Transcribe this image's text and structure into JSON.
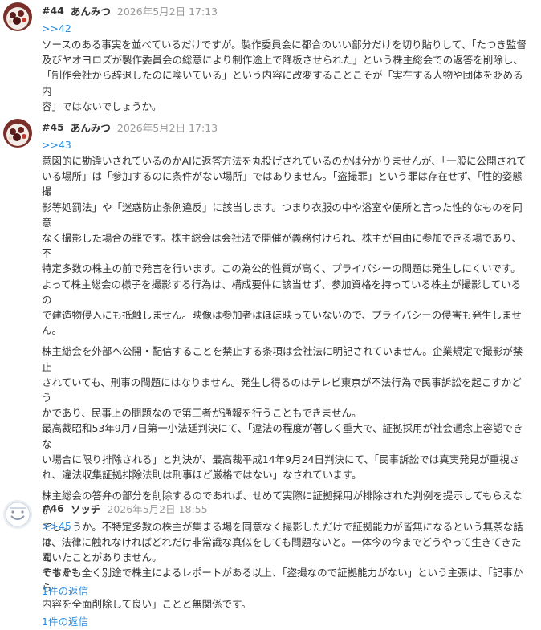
{
  "posts": [
    {
      "number": "#44",
      "name": "あんみつ",
      "date": "2026年5月2日 17:13",
      "anchor": ">>42",
      "lines": [
        "ソースのある事実を並べているだけですが。製作委員会に都合のいい部分だけを切り貼りして、「たつき監督",
        "及びヤオヨロズが製作委員会の総意により制作途上で降板させられた」という株主総会での返答を削除し、",
        "「制作会社から辞退したのに喚いている」という内容に改変することこそが「実在する人物や団体を貶める内",
        "容」ではないでしょうか。"
      ]
    },
    {
      "number": "#45",
      "name": "あんみつ",
      "date": "2026年5月2日 17:13",
      "anchor": ">>43",
      "blocks": [
        [
          "意図的に勘違いされているのかAIに返答方法を丸投げされているのかは分かりませんが、「一般に公開されて",
          "いる場所」は「参加するのに条件がない場所」ではありません。「盗撮罪」という罪は存在せず、「性的姿態撮",
          "影等処罰法」や「迷惑防止条例違反」に該当します。つまり衣服の中や浴室や便所と言った性的なものを同意",
          "なく撮影した場合の罪です。株主総会は会社法で開催が義務付けられ、株主が自由に参加できる場であり、不",
          "特定多数の株主の前で発言を行います。この為公的性質が高く、プライバシーの問題は発生しにくいです。",
          "よって株主総会の様子を撮影する行為は、構成要件に該当せず、参加資格を持っている株主が撮影しているの",
          "で建造物侵入にも抵触しません。映像は参加者はほぼ映っていないので、プライバシーの侵害も発生しませ",
          "ん。"
        ],
        [
          "株主総会を外部へ公開・配信することを禁止する条項は会社法に明記されていません。企業規定で撮影が禁止",
          "されていても、刑事の問題にはなりません。発生し得るのはテレビ東京が不法行為で民事訴訟を起こすかどう",
          "かであり、民事上の問題なので第三者が通報を行うこともできません。",
          "最高裁昭和53年9月7日第一小法廷判決にて、「違法の程度が著しく重大で、証拠採用が社会通念上容認できな",
          "い場合に限り排除される」と判決が、最高裁平成14年9月24日判決にて、「民事訴訟では真実発見が重視さ",
          "れ、違法収集証拠排除法則は刑事ほど厳格ではない」なされています。"
        ],
        [
          "株主総会の答弁の部分を削除するのであれば、せめて実際に証拠採用が排除された判例を提示してもらえない",
          "でしょうか。不特定多数の株主が集まる場を同意なく撮影しただけで証拠能力が皆無になるという無茶な話は",
          "聞いたことがありません。",
          "そもそも全く別途で株主によるレポートがある以上、「盗撮なので証拠能力がない」という主張は、「記事から",
          "内容を全面削除して良い」ことと無関係です。"
        ]
      ],
      "reply_link": "1件の返信"
    },
    {
      "number": "#46",
      "name": "ソッチ",
      "date": "2026年5月2日 18:55",
      "anchor": ">>45",
      "lines": [
        "で、法律に触れなければどれだけ非常識な真似をしても問題ないと。一体今の今までどうやって生きてきたん",
        "ですか？"
      ],
      "reply_link": "1件の返信"
    }
  ],
  "icons": {
    "avatar_44": "anmitsu-dessert-avatar",
    "avatar_45": "anmitsu-dessert-avatar",
    "avatar_46": "default-user-avatar"
  },
  "colors": {
    "link": "#2f8bdc",
    "date": "#999999",
    "text": "#333333"
  }
}
